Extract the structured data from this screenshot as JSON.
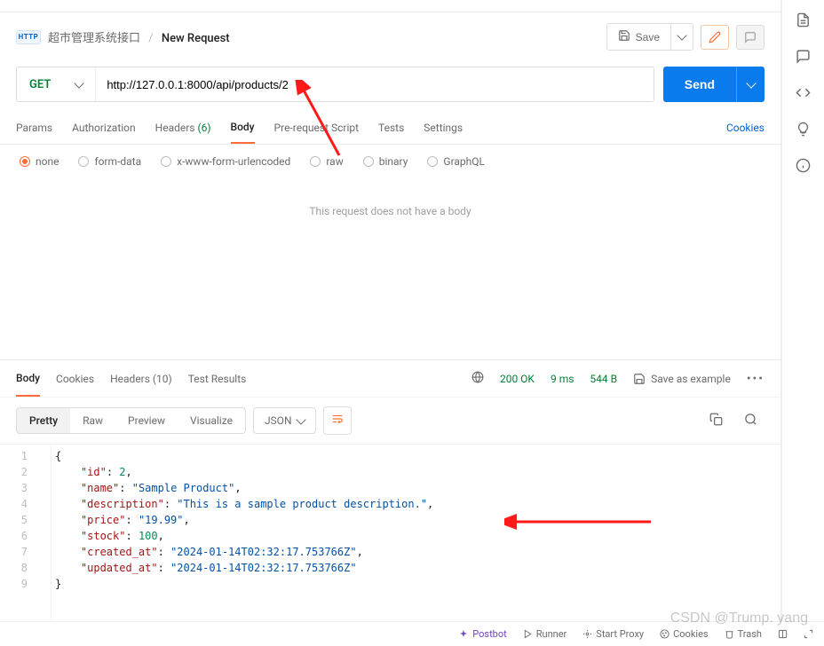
{
  "breadcrumb": {
    "collection": "超市管理系统接口",
    "request": "New Request"
  },
  "toolbar": {
    "save": "Save"
  },
  "method": "GET",
  "url": "http://127.0.0.1:8000/api/products/2",
  "send": "Send",
  "reqTabs": {
    "params": "Params",
    "auth": "Authorization",
    "headers": "Headers",
    "headers_count": "(6)",
    "body": "Body",
    "prereq": "Pre-request Script",
    "tests": "Tests",
    "settings": "Settings"
  },
  "cookies_link": "Cookies",
  "bodyTypes": {
    "none": "none",
    "formdata": "form-data",
    "xwww": "x-www-form-urlencoded",
    "raw": "raw",
    "binary": "binary",
    "graphql": "GraphQL"
  },
  "noBody": "This request does not have a body",
  "respTabs": {
    "body": "Body",
    "cookies": "Cookies",
    "headers": "Headers",
    "headers_count": "(10)",
    "test": "Test Results"
  },
  "statusText": "200 OK",
  "timeText": "9 ms",
  "sizeText": "544 B",
  "saveExample": "Save as example",
  "viewModes": {
    "pretty": "Pretty",
    "raw": "Raw",
    "preview": "Preview",
    "visualize": "Visualize"
  },
  "format": "JSON",
  "responseJson": {
    "id": 2,
    "name": "Sample Product",
    "description": "This is a sample product description.",
    "price": "19.99",
    "stock": 100,
    "created_at": "2024-01-14T02:32:17.753766Z",
    "updated_at": "2024-01-14T02:32:17.753766Z"
  },
  "footer": {
    "postbot": "Postbot",
    "runner": "Runner",
    "startproxy": "Start Proxy",
    "cookies": "Cookies",
    "trash": "Trash"
  },
  "watermark": "CSDN @Trump. yang"
}
